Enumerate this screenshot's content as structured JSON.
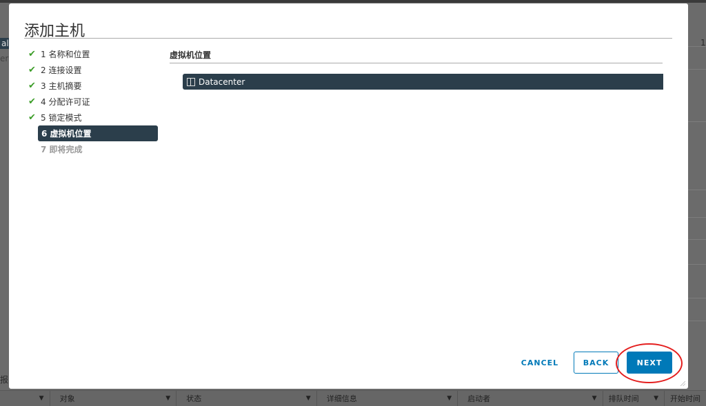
{
  "background": {
    "fragments": [
      "al",
      "er",
      "报",
      "1"
    ],
    "columns": [
      {
        "label": ""
      },
      {
        "label": "对象"
      },
      {
        "label": "状态"
      },
      {
        "label": "详细信息"
      },
      {
        "label": "启动者"
      },
      {
        "label": "排队时间"
      },
      {
        "label": "开始时间"
      }
    ]
  },
  "dialog": {
    "title": "添加主机",
    "steps": [
      {
        "label": "1 名称和位置",
        "state": "done"
      },
      {
        "label": "2 连接设置",
        "state": "done"
      },
      {
        "label": "3 主机摘要",
        "state": "done"
      },
      {
        "label": "4 分配许可证",
        "state": "done"
      },
      {
        "label": "5 锁定模式",
        "state": "done"
      },
      {
        "label": "6 虚拟机位置",
        "state": "active"
      },
      {
        "label": "7 即将完成",
        "state": "future"
      }
    ],
    "section_title": "虚拟机位置",
    "tree_item": {
      "label": "Datacenter",
      "icon": "datacenter-icon"
    },
    "buttons": {
      "cancel": "CANCEL",
      "back": "BACK",
      "next": "NEXT"
    },
    "colors": {
      "accent": "#0079b8",
      "selected": "#2b3e4b",
      "check": "#3c9d28",
      "annotation": "#e41e1e"
    }
  }
}
